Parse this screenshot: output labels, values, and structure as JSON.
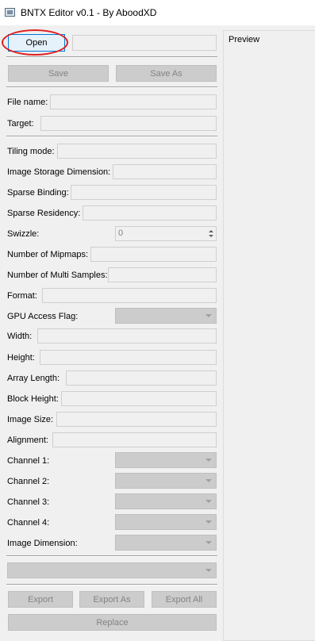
{
  "window": {
    "title": "BNTX Editor v0.1 - By AboodXD"
  },
  "toolbar": {
    "open_label": "Open",
    "save_label": "Save",
    "save_as_label": "Save As"
  },
  "fields": {
    "file_name": "File name:",
    "target": "Target:",
    "tiling_mode": "Tiling mode:",
    "image_storage_dimension": "Image Storage Dimension:",
    "sparse_binding": "Sparse Binding:",
    "sparse_residency": "Sparse Residency:",
    "swizzle": "Swizzle:",
    "swizzle_value": "0",
    "num_mipmaps": "Number of Mipmaps:",
    "num_multi_samples": "Number of Multi Samples:",
    "format": "Format:",
    "gpu_access_flag": "GPU Access Flag:",
    "width": "Width:",
    "height": "Height:",
    "array_length": "Array Length:",
    "block_height": "Block Height:",
    "image_size": "Image Size:",
    "alignment": "Alignment:",
    "channel_1": "Channel 1:",
    "channel_2": "Channel 2:",
    "channel_3": "Channel 3:",
    "channel_4": "Channel 4:",
    "image_dimension": "Image Dimension:"
  },
  "actions": {
    "export_label": "Export",
    "export_as_label": "Export As",
    "export_all_label": "Export All",
    "replace_label": "Replace"
  },
  "preview": {
    "title": "Preview"
  },
  "colors": {
    "annotation": "#e02020",
    "focus_border": "#0078d7"
  }
}
